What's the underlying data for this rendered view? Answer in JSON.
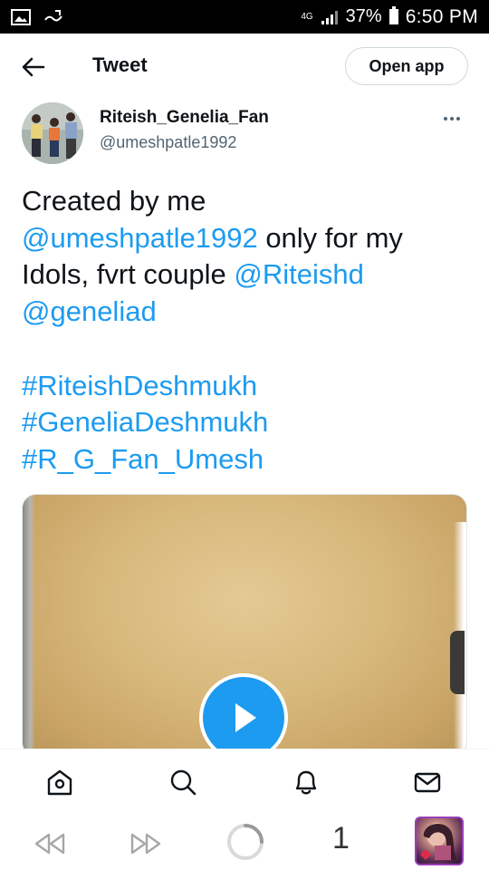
{
  "status_bar": {
    "network": "4G",
    "battery_percent": "37%",
    "time": "6:50 PM"
  },
  "header": {
    "title": "Tweet",
    "open_app_label": "Open app"
  },
  "tweet": {
    "author_name": "Riteish_Genelia_Fan",
    "author_handle": "@umeshpatle1992",
    "text_line1": "Created by me",
    "mention_umesh": "@umeshpatle1992",
    "text_after_mention": " only for my",
    "text_idols": "Idols, fvrt couple ",
    "mention_riteishd": "@Riteishd",
    "mention_geneliad": "@geneliad",
    "hashtag1": "#RiteishDeshmukh",
    "hashtag2": "#GeneliaDeshmukh",
    "hashtag3": "#R_G_Fan_Umesh"
  },
  "bottom_nav": {
    "items": [
      "home-icon",
      "search-icon",
      "notifications-icon",
      "messages-icon"
    ]
  },
  "browser_bar": {
    "tab_count": "1"
  },
  "colors": {
    "link": "#1d9bf0",
    "text": "#0f1419",
    "secondary": "#536471",
    "status_bar": "#000000"
  }
}
